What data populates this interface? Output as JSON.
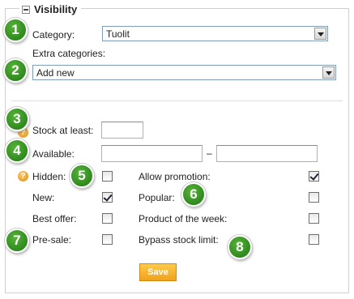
{
  "section": {
    "title": "Visibility"
  },
  "category": {
    "label": "Category:",
    "value": "Tuolit"
  },
  "extra_categories": {
    "label": "Extra categories:",
    "value": "Add new"
  },
  "stock": {
    "label": "Stock at least:"
  },
  "available": {
    "label": "Available:",
    "separator": "–"
  },
  "flags": {
    "hidden": {
      "label": "Hidden:",
      "checked": false
    },
    "allow_promotion": {
      "label": "Allow promotion:",
      "checked": true
    },
    "new": {
      "label": "New:",
      "checked": true
    },
    "popular": {
      "label": "Popular:",
      "checked": false
    },
    "best_offer": {
      "label": "Best offer:",
      "checked": false
    },
    "product_of_week": {
      "label": "Product of the week:",
      "checked": false
    },
    "pre_sale": {
      "label": "Pre-sale:",
      "checked": false
    },
    "bypass_stock_limit": {
      "label": "Bypass stock limit:",
      "checked": false
    }
  },
  "help_icon": {
    "glyph": "?"
  },
  "badges": [
    "1",
    "2",
    "3",
    "4",
    "5",
    "6",
    "7",
    "8"
  ],
  "save": {
    "label": "Save"
  },
  "colors": {
    "badge_green": "#2e8a1d",
    "save_orange": "#f0a11c",
    "help_orange": "#e08b14"
  }
}
